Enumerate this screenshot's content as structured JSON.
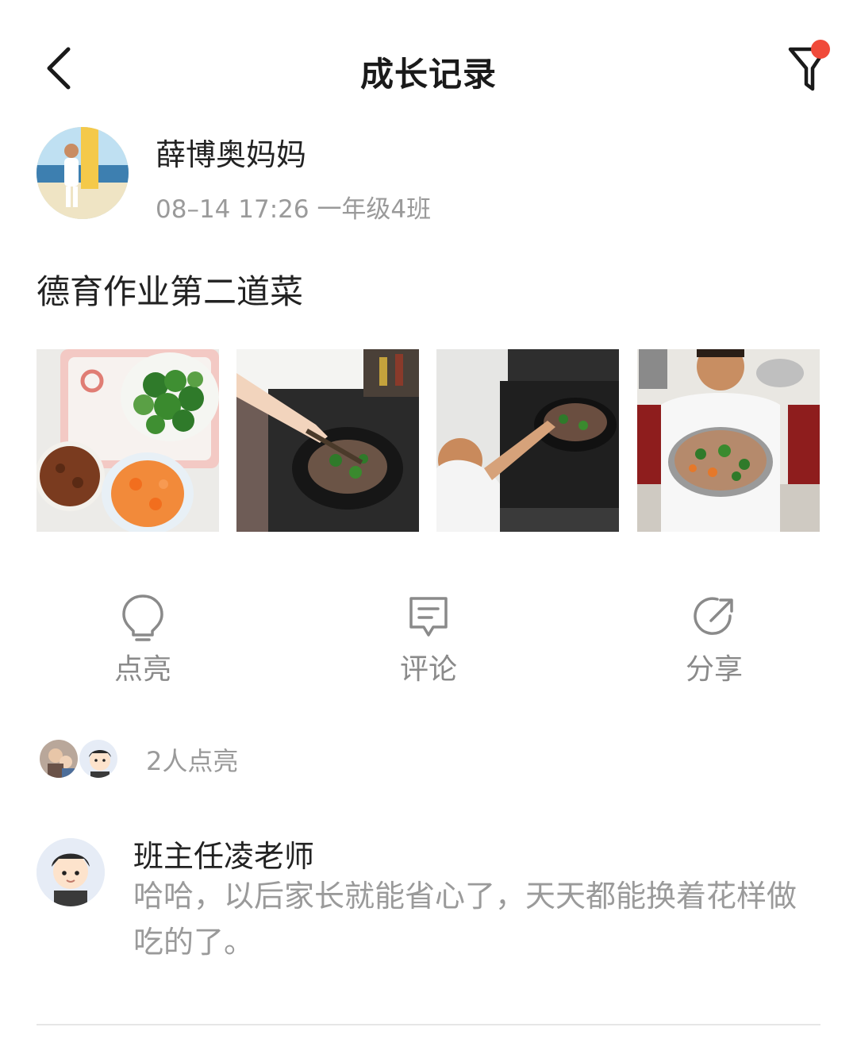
{
  "header": {
    "title": "成长记录",
    "back_icon": "chevron-left-icon",
    "filter_icon": "filter-icon",
    "notification_dot_color": "#f04a3a"
  },
  "post": {
    "author": "薛博奥妈妈",
    "meta": "08–14 17:26 一年级4班",
    "text": "德育作业第二道菜",
    "photos": [
      {
        "subject": "ingredients-vegetables"
      },
      {
        "subject": "stir-frying"
      },
      {
        "subject": "child-cooking"
      },
      {
        "subject": "finished-dish"
      }
    ]
  },
  "actions": [
    {
      "label": "点亮",
      "icon": "lightbulb-icon"
    },
    {
      "label": "评论",
      "icon": "comment-icon"
    },
    {
      "label": "分享",
      "icon": "share-icon"
    }
  ],
  "likes": {
    "count_label": "2人点亮"
  },
  "comment": {
    "author": "班主任凌老师",
    "text": "哈哈，以后家长就能省心了，天天都能换着花样做吃的了。"
  }
}
